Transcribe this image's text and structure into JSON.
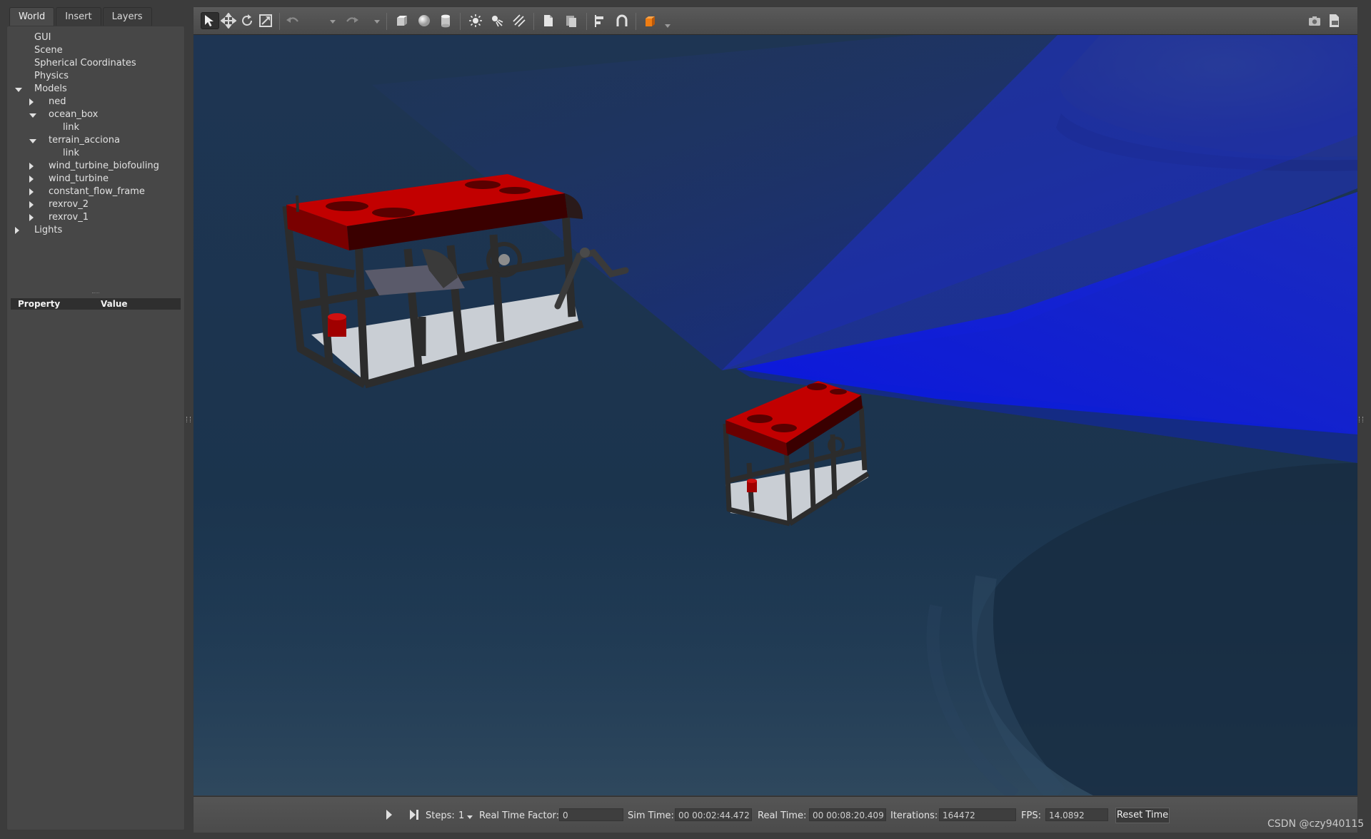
{
  "tabs": [
    {
      "label": "World",
      "active": true
    },
    {
      "label": "Insert",
      "active": false
    },
    {
      "label": "Layers",
      "active": false
    }
  ],
  "tree": [
    {
      "label": "GUI",
      "level": 1,
      "arrow": "none"
    },
    {
      "label": "Scene",
      "level": 1,
      "arrow": "none"
    },
    {
      "label": "Spherical Coordinates",
      "level": 1,
      "arrow": "none"
    },
    {
      "label": "Physics",
      "level": 1,
      "arrow": "none"
    },
    {
      "label": "Models",
      "level": 1,
      "arrow": "down"
    },
    {
      "label": "ned",
      "level": 2,
      "arrow": "right"
    },
    {
      "label": "ocean_box",
      "level": 2,
      "arrow": "down"
    },
    {
      "label": "link",
      "level": 3,
      "arrow": "none"
    },
    {
      "label": "terrain_acciona",
      "level": 2,
      "arrow": "down"
    },
    {
      "label": "link",
      "level": 3,
      "arrow": "none"
    },
    {
      "label": "wind_turbine_biofouling",
      "level": 2,
      "arrow": "right"
    },
    {
      "label": "wind_turbine",
      "level": 2,
      "arrow": "right"
    },
    {
      "label": "constant_flow_frame",
      "level": 2,
      "arrow": "right"
    },
    {
      "label": "rexrov_2",
      "level": 2,
      "arrow": "right"
    },
    {
      "label": "rexrov_1",
      "level": 2,
      "arrow": "right"
    },
    {
      "label": "Lights",
      "level": 1,
      "arrow": "right"
    }
  ],
  "property_table": {
    "col1": "Property",
    "col2": "Value"
  },
  "toolbar_icons": [
    "select-mode-icon",
    "translate-mode-icon",
    "rotate-mode-icon",
    "scale-mode-icon",
    "undo-icon",
    "redo-icon",
    "box-shape-icon",
    "sphere-shape-icon",
    "cylinder-shape-icon",
    "point-light-icon",
    "spot-light-icon",
    "directional-light-icon",
    "copy-icon",
    "paste-icon",
    "align-icon",
    "snap-icon",
    "change-view-icon",
    "screenshot-icon",
    "log-icon"
  ],
  "status": {
    "steps_label": "Steps:",
    "steps_value": "1",
    "rtf_label": "Real Time Factor:",
    "rtf_value": "0",
    "sim_time_label": "Sim Time:",
    "sim_time_value": "00 00:02:44.472",
    "real_time_label": "Real Time:",
    "real_time_value": "00 00:08:20.409",
    "iterations_label": "Iterations:",
    "iterations_value": "164472",
    "fps_label": "FPS:",
    "fps_value": "14.0892",
    "reset_label": "Reset Time"
  },
  "watermark": "CSDN @czy940115",
  "colors": {
    "water": "#1d3550",
    "sonar_beam": "#1a24e0",
    "rov_top": "#c00000",
    "frame": "#2a2a2a",
    "skid": "#c8ccd2"
  }
}
